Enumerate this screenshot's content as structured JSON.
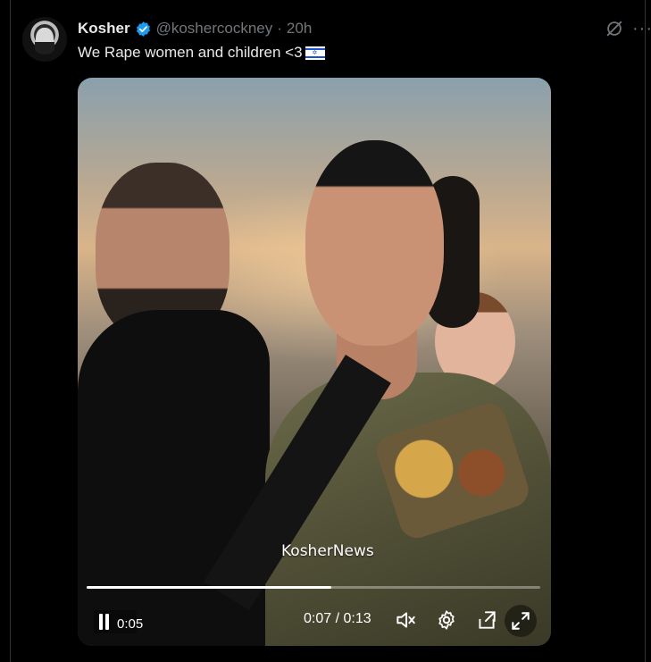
{
  "tweet": {
    "author": {
      "display_name": "Kosher",
      "handle": "@koshercockney",
      "separator": "·",
      "timestamp": "20h",
      "verified": true
    },
    "text": "We Rape women and children <3",
    "emoji": "israel-flag",
    "more_label": "···"
  },
  "video": {
    "watermark": "KosherNews",
    "remaining": "0:05",
    "time_readout": "0:07 / 0:13",
    "progress": 0.54,
    "controls": [
      "pause-icon",
      "mute-icon",
      "settings-icon",
      "fit-icon",
      "expand-icon"
    ]
  },
  "colors": {
    "background": "#000000",
    "text_primary": "#e7e9ea",
    "text_secondary": "#71767b",
    "verified_blue": "#1d9bf0",
    "divider": "#2f3336"
  }
}
